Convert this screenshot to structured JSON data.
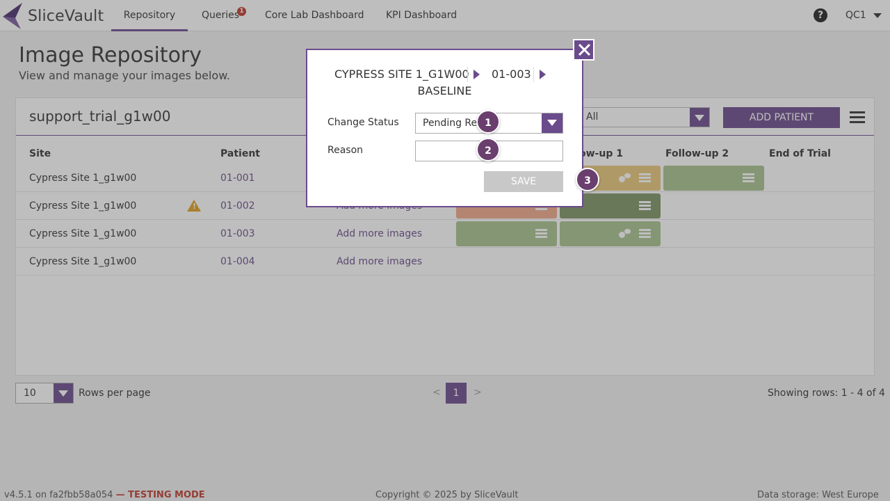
{
  "app": {
    "name": "SliceVault"
  },
  "nav": {
    "items": [
      {
        "label": "Repository",
        "active": true
      },
      {
        "label": "Queries",
        "badge": "1"
      },
      {
        "label": "Core Lab Dashboard"
      },
      {
        "label": "KPI Dashboard"
      }
    ],
    "help_icon": "?",
    "user": "QC1"
  },
  "page": {
    "title": "Image Repository",
    "subtitle": "View and manage your images below."
  },
  "trial": {
    "name": "support_trial_g1w00",
    "filter_value": "All",
    "add_patient_label": "ADD PATIENT"
  },
  "table": {
    "headers": {
      "site": "Site",
      "patient": "Patient",
      "followup1": "ow-up 1",
      "followup2": "Follow-up 2",
      "end": "End of Trial"
    },
    "rows": [
      {
        "site": "Cypress Site 1_g1w00",
        "patient": "01-001",
        "action": "",
        "warning": false
      },
      {
        "site": "Cypress Site 1_g1w00",
        "patient": "01-002",
        "action": "Add more images",
        "warning": true
      },
      {
        "site": "Cypress Site 1_g1w00",
        "patient": "01-003",
        "action": "Add more images",
        "warning": false
      },
      {
        "site": "Cypress Site 1_g1w00",
        "patient": "01-004",
        "action": "Add more images",
        "warning": false
      }
    ],
    "tile_colors": {
      "yellow": "#e8c87a",
      "green": "#a8c28e",
      "dark_green": "#7e9466",
      "salmon": "#f0a888"
    }
  },
  "pagination": {
    "rows_per_page_value": "10",
    "rows_per_page_label": "Rows per page",
    "prev": "<",
    "current": "1",
    "next": ">",
    "showing": "Showing rows: 1 - 4 of 4"
  },
  "footer": {
    "version": "v4.5.1 on fa2fbb58a054",
    "mode": "— TESTING MODE",
    "copyright": "Copyright © 2025 by SliceVault",
    "storage": "Data storage: West Europe"
  },
  "modal": {
    "crumb_site": "CYPRESS SITE 1_G1W00",
    "crumb_patient": "01-003",
    "crumb_visit": "BASELINE",
    "change_status_label": "Change Status",
    "status_value": "Pending Rea",
    "reason_label": "Reason",
    "reason_value": "",
    "save_label": "SAVE"
  },
  "steps": [
    "1",
    "2",
    "3"
  ],
  "colors": {
    "accent": "#6a4b8c",
    "warning": "#e0a020",
    "testing": "#c0392b"
  }
}
